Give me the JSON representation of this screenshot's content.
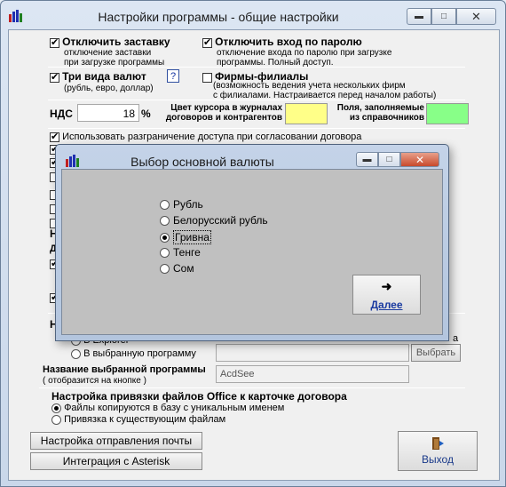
{
  "window": {
    "title": "Настройки программы - общие настройки"
  },
  "settings": {
    "disable_splash": {
      "label": "Отключить заставку",
      "desc1": "отключение заставки",
      "desc2": "при загрузке программы"
    },
    "disable_password": {
      "label": "Отключить вход по паролю",
      "desc1": "отключение входа по паролю при загрузке",
      "desc2": "программы. Полный доступ."
    },
    "three_currencies": {
      "label": "Три вида валют",
      "desc": "(рубль, евро, доллар)",
      "help": "?"
    },
    "branches": {
      "label": "Фирмы-филиалы",
      "desc1": "(возможность ведения учета нескольких фирм",
      "desc2": "с филиалами. Настраивается перед началом работы)"
    },
    "vat": {
      "label": "НДС",
      "value": "18",
      "unit": "%"
    },
    "cursor_color": {
      "line1": "Цвет курсора в журналах",
      "line2": "договоров и контрагентов",
      "color": "#ffff88"
    },
    "filled_fields": {
      "line1": "Поля, заполняемые",
      "line2": "из справочников",
      "color": "#88ff88"
    },
    "access_control": {
      "label": "Использовать разграничение доступа при согласовании договора"
    },
    "partial_h1": "Н",
    "partial_d": "Д",
    "partial_h2": "Н",
    "partial_a": "а",
    "open_in": {
      "explorer_label": "В Explorer",
      "program_label": "В выбранную программу",
      "select_button": "Выбрать"
    },
    "program_name": {
      "label": "Название выбранной программы",
      "note": "( отобразится на кнопке )",
      "value": "AcdSee"
    },
    "office_binding": {
      "title": "Настройка привязки файлов Office к карточке договора",
      "options": [
        {
          "label": "Файлы копируются в базу с уникальным именем",
          "selected": true
        },
        {
          "label": "Привязка к существующим файлам",
          "selected": false
        }
      ]
    },
    "mail_button": "Настройка отправления почты",
    "asterisk_button": "Интеграция с Asterisk",
    "exit_button": "Выход"
  },
  "dialog": {
    "title": "Выбор основной валюты",
    "options": [
      {
        "label": "Рубль",
        "selected": false
      },
      {
        "label": "Белорусский рубль",
        "selected": false
      },
      {
        "label": "Гривна",
        "selected": true
      },
      {
        "label": "Тенге",
        "selected": false
      },
      {
        "label": "Сом",
        "selected": false
      }
    ],
    "next_button": "Далее",
    "next_icon": "arrow-right-icon"
  }
}
